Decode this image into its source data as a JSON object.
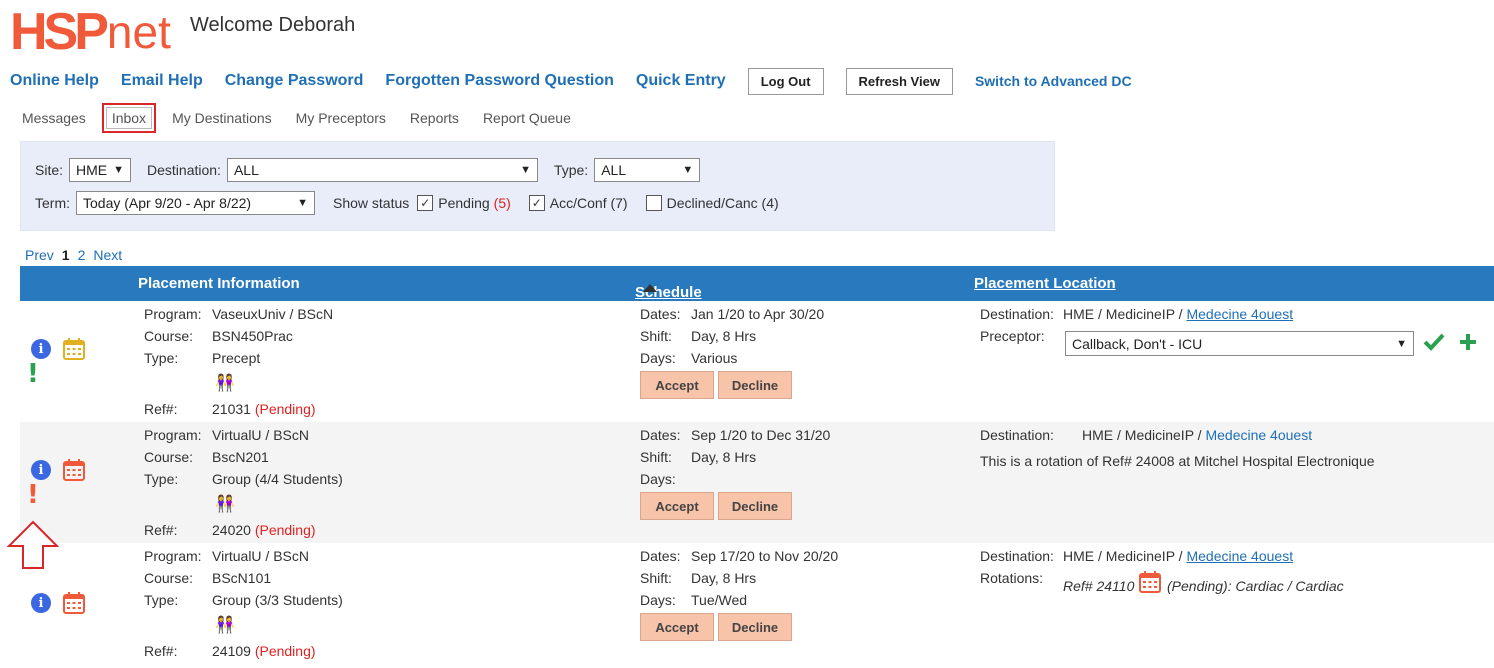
{
  "header": {
    "logo_hsp": "HSP",
    "logo_net": "net",
    "welcome": "Welcome Deborah"
  },
  "toplinks": {
    "online_help": "Online Help",
    "email_help": "Email Help",
    "change_password": "Change Password",
    "forgotten_password": "Forgotten Password Question",
    "quick_entry": "Quick Entry",
    "log_out": "Log Out",
    "refresh_view": "Refresh View",
    "switch_advanced": "Switch to Advanced DC"
  },
  "tabs": [
    "Messages",
    "Inbox",
    "My Destinations",
    "My Preceptors",
    "Reports",
    "Report Queue"
  ],
  "filters": {
    "site_label": "Site:",
    "site_value": "HME",
    "destination_label": "Destination:",
    "destination_value": "ALL",
    "type_label": "Type:",
    "type_value": "ALL",
    "term_label": "Term:",
    "term_value": "Today (Apr 9/20 - Apr 8/22)",
    "show_status_label": "Show status",
    "pending_label": "Pending",
    "pending_count": "(5)",
    "accconf_label": "Acc/Conf (7)",
    "declined_label": "Declined/Canc (4)"
  },
  "pager": {
    "prev": "Prev",
    "page1": "1",
    "page2": "2",
    "next": "Next"
  },
  "table": {
    "col_info": "Placement Information",
    "col_schedule": "Schedule",
    "col_location": "Placement Location"
  },
  "labels": {
    "program": "Program:",
    "course": "Course:",
    "type": "Type:",
    "ref": "Ref#:",
    "dates": "Dates:",
    "shift": "Shift:",
    "days": "Days:",
    "destination": "Destination:",
    "preceptor": "Preceptor:",
    "rotations": "Rotations:",
    "accept": "Accept",
    "decline": "Decline"
  },
  "rows": [
    {
      "program": "VaseuxUniv / BScN",
      "course": "BSN450Prac",
      "type": "Precept",
      "ref": "21031",
      "status": "(Pending)",
      "dates": "Jan 1/20 to Apr 30/20",
      "shift": "Day, 8 Hrs",
      "days": "Various",
      "dest_prefix": "HME / MedicineIP / ",
      "dest_link": "Medecine 4ouest",
      "preceptor_value": "Callback, Don't - ICU"
    },
    {
      "program": "VirtualU / BScN",
      "course": "BscN201",
      "type": "Group (4/4 Students)",
      "ref": "24020",
      "status": "(Pending)",
      "dates": "Sep 1/20 to Dec 31/20",
      "shift": "Day, 8 Hrs",
      "days": "",
      "dest_prefix": "HME / MedicineIP / ",
      "dest_link": "Medecine 4ouest",
      "rotation_note": "This is a rotation of Ref# 24008 at Mitchel Hospital Electronique"
    },
    {
      "program": "VirtualU / BScN",
      "course": "BScN101",
      "type": "Group (3/3 Students)",
      "ref": "24109",
      "status": "(Pending)",
      "dates": "Sep 17/20 to Nov 20/20",
      "shift": "Day, 8 Hrs",
      "days": "Tue/Wed",
      "dest_prefix": "HME / MedicineIP / ",
      "dest_link": "Medecine 4ouest",
      "rotation_ref": "Ref# 24110",
      "rotation_detail": "(Pending): Cardiac / Cardiac"
    }
  ],
  "colors": {
    "brand": "#f05a3a",
    "link": "#1f6fb5",
    "header_bar": "#2879bd",
    "accept_button": "#f7c3a9",
    "pending": "#e02020"
  }
}
